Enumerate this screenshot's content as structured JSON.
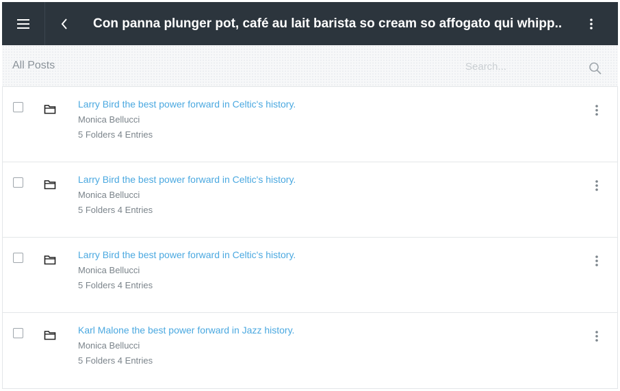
{
  "header": {
    "title": "Con panna plunger pot, café au lait barista so cream so affogato qui whipp.."
  },
  "subbar": {
    "breadcrumb": "All Posts",
    "search_placeholder": "Search..."
  },
  "rows": [
    {
      "title": "Larry Bird the best power forward in Celtic's history.",
      "author": "Monica Bellucci",
      "meta": "5 Folders 4 Entries"
    },
    {
      "title": "Larry Bird the best power forward in Celtic's history.",
      "author": "Monica Bellucci",
      "meta": "5 Folders 4 Entries"
    },
    {
      "title": "Larry Bird the best power forward in Celtic's history.",
      "author": "Monica Bellucci",
      "meta": "5 Folders 4 Entries"
    },
    {
      "title": "Karl Malone the best power forward in Jazz history.",
      "author": "Monica Bellucci",
      "meta": "5 Folders 4 Entries"
    }
  ],
  "icons": {
    "menu": "hamburger-menu-icon",
    "back": "chevron-left-icon",
    "more": "vertical-dots-icon",
    "search": "search-icon",
    "folder": "folder-icon"
  },
  "colors": {
    "topbar": "#2c353d",
    "link": "#4aa8e0",
    "muted": "#7b848b"
  }
}
